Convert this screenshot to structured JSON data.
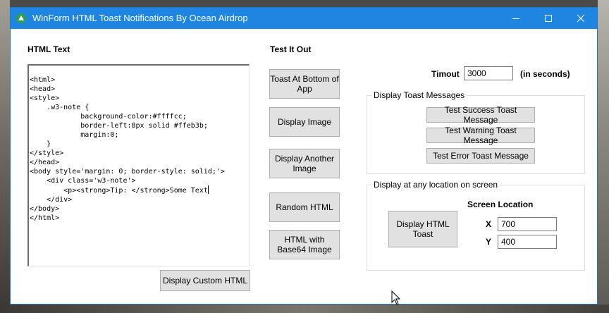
{
  "window": {
    "title": "WinForm HTML Toast Notifications By Ocean Airdrop",
    "controls": {
      "minimize_icon": "minimize-icon",
      "maximize_icon": "maximize-icon",
      "close_icon": "close-icon"
    },
    "accent_color": "#1e86e0"
  },
  "html_text": {
    "heading": "HTML Text",
    "lines": [
      "<html>",
      "<head>",
      "<style>",
      "    .w3-note {",
      "            background-color:#ffffcc;",
      "            border-left:8px solid #ffeb3b;",
      "            margin:0;",
      "    }",
      "</style>",
      "</head>",
      "<body style='margin: 0; border-style: solid;'>",
      "    <div class='w3-note'>",
      "        <p><strong>Tip: </strong>Some Text",
      "    </div>",
      "</body>",
      "</html>"
    ],
    "display_button": "Display Custom HTML"
  },
  "test_it_out": {
    "heading": "Test It Out",
    "buttons": [
      "Toast At Bottom of App",
      "Display Image",
      "Display Another Image",
      "Random HTML",
      "HTML with Base64 Image"
    ]
  },
  "timeout": {
    "label": "Timout",
    "value": "3000",
    "suffix": "(in seconds)"
  },
  "toast_messages": {
    "legend": "Display Toast Messages",
    "buttons": [
      "Test Success Toast Message",
      "Test Warning Toast Message",
      "Test Error Toast Message"
    ]
  },
  "location": {
    "legend": "Display at any location on screen",
    "display_button": "Display HTML Toast",
    "screen_location_label": "Screen Location",
    "x_label": "X",
    "x_value": "700",
    "y_label": "Y",
    "y_value": "400"
  }
}
